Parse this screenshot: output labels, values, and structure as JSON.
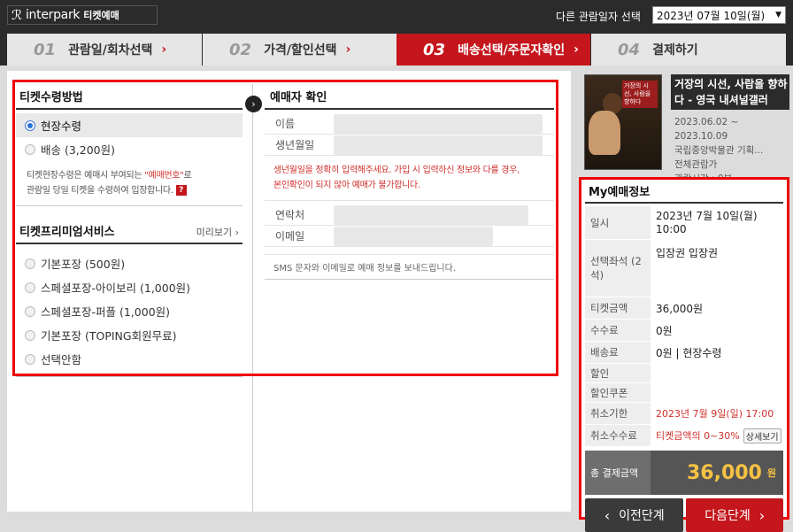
{
  "header": {
    "logo_text": "interpark",
    "logo_sub": "티켓예매",
    "date_label": "다른 관람일자 선택",
    "date_value": "2023년 07월 10일(월)",
    "date_arrow": "▼"
  },
  "steps": [
    {
      "num": "01",
      "label": "관람일/회차선택",
      "arrow": "›"
    },
    {
      "num": "02",
      "label": "가격/할인선택",
      "arrow": "›"
    },
    {
      "num": "03",
      "label": "배송선택/주문자확인",
      "arrow": "›"
    },
    {
      "num": "04",
      "label": "결제하기"
    }
  ],
  "delivery": {
    "title": "티켓수령방법",
    "options": [
      "현장수령",
      "배송 (3,200원)"
    ],
    "note_a": "티켓현장수령은 예매시 부여되는 ",
    "note_red": "\"예매번호\"",
    "note_b": "로",
    "note_c": "관람일 당일 티켓을 수령하여 입장합니다.",
    "help": "?"
  },
  "premium": {
    "title": "티켓프리미엄서비스",
    "preview": "미리보기 ›",
    "options": [
      "기본포장 (500원)",
      "스페셜포장-아이보리 (1,000원)",
      "스페셜포장-퍼플 (1,000원)",
      "기본포장 (TOPING회원무료)",
      "선택안함"
    ]
  },
  "buyer": {
    "title": "예매자 확인",
    "name_label": "이름",
    "birth_label": "생년월일",
    "birth_note_1": "생년월일을 정확히 입력해주세요. 가입 시 입력하신 정보와 다를 경우,",
    "birth_note_2": "본인확인이 되지 않아 예매가 불가합니다.",
    "phone_label": "연락처",
    "email_label": "이메일",
    "sms_note": "SMS 문자와 이메일로 예매 정보를 보내드립니다."
  },
  "expand_icon": "›",
  "event": {
    "poster_text": "거장의 시선, 사람을 향하다",
    "title": "거장의 시선, 사람을 향하다 - 영국 내셔널갤러",
    "dates": "2023.06.02 ~ 2023.10.09",
    "venue": "국립중앙박물관 기획...",
    "age": "전체관람가",
    "time": "관람시간 : 0분"
  },
  "my": {
    "title": "My예매정보",
    "rows": [
      {
        "k": "일시",
        "v": "2023년 7월 10일(월) 10:00"
      },
      {
        "k": "선택좌석 (2석)",
        "v": "입장권 입장권"
      },
      {
        "k": "티켓금액",
        "v": "36,000원"
      },
      {
        "k": "수수료",
        "v": "0원"
      },
      {
        "k": "배송료",
        "v": "0원 | 현장수령"
      },
      {
        "k": "할인",
        "v": ""
      },
      {
        "k": "할인쿠폰",
        "v": ""
      },
      {
        "k": "취소기한",
        "v": "2023년 7월 9일(일) 17:00"
      },
      {
        "k": "취소수수료",
        "v": "티켓금액의 0~30%"
      }
    ],
    "fee_detail": "상세보기",
    "total_label": "총 결제금액",
    "total_amount": "36,000",
    "total_unit": "원",
    "prev": "이전단계",
    "next": "다음단계"
  }
}
